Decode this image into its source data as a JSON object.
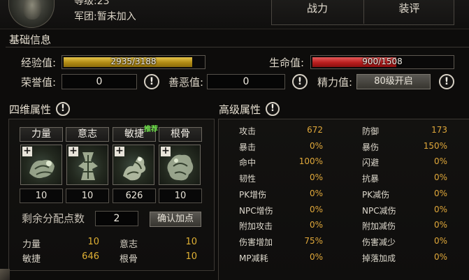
{
  "header": {
    "level": "等级:23",
    "corps": "军团:暂未加入",
    "tabs": [
      {
        "label": "战力"
      },
      {
        "label": "装评"
      }
    ]
  },
  "basic": {
    "title": "基础信息",
    "exp_label": "经验值:",
    "exp_value": "2935/3188",
    "exp_fraction": 0.92,
    "hp_label": "生命值:",
    "hp_value": "900/1508",
    "hp_fraction": 0.6,
    "honor_label": "荣誉值:",
    "honor_value": "0",
    "karma_label": "善恶值:",
    "karma_value": "0",
    "energy_label": "精力值:",
    "energy_button": "80级开启",
    "info_glyph": "!"
  },
  "four": {
    "title": "四维属性",
    "attrs": [
      {
        "name": "力量",
        "value": "10",
        "icon": "strength-icon"
      },
      {
        "name": "意志",
        "value": "10",
        "icon": "will-icon"
      },
      {
        "name": "敏捷",
        "value": "626",
        "icon": "agility-icon"
      },
      {
        "name": "根骨",
        "value": "10",
        "icon": "constitution-icon"
      }
    ],
    "recommend_tag": "推荐",
    "plus_glyph": "+",
    "remain_label": "剩余分配点数",
    "remain_value": "2",
    "confirm_label": "确认加点",
    "summary": [
      {
        "label": "力量",
        "value": "10"
      },
      {
        "label": "意志",
        "value": "10"
      },
      {
        "label": "敏捷",
        "value": "646"
      },
      {
        "label": "根骨",
        "value": "10"
      }
    ]
  },
  "advanced": {
    "title": "高级属性",
    "rows": [
      {
        "l1": "攻击",
        "v1": "672",
        "l2": "防御",
        "v2": "173"
      },
      {
        "l1": "暴击",
        "v1": "0%",
        "l2": "暴伤",
        "v2": "150%"
      },
      {
        "l1": "命中",
        "v1": "100%",
        "l2": "闪避",
        "v2": "0%"
      },
      {
        "l1": "韧性",
        "v1": "0%",
        "l2": "抗暴",
        "v2": "0%"
      },
      {
        "l1": "PK增伤",
        "v1": "0%",
        "l2": "PK减伤",
        "v2": "0%"
      },
      {
        "l1": "NPC增伤",
        "v1": "0%",
        "l2": "NPC减伤",
        "v2": "0%"
      },
      {
        "l1": "附加攻击",
        "v1": "0%",
        "l2": "附加减伤",
        "v2": "0%"
      },
      {
        "l1": "伤害增加",
        "v1": "75%",
        "l2": "伤害减少",
        "v2": "0%"
      },
      {
        "l1": "MP减耗",
        "v1": "0%",
        "l2": "掉落加成",
        "v2": "0%"
      }
    ]
  },
  "colors": {
    "value_gold": "#e0a83a",
    "exp_bar": "#c9a21e",
    "hp_bar": "#b81e1e"
  }
}
